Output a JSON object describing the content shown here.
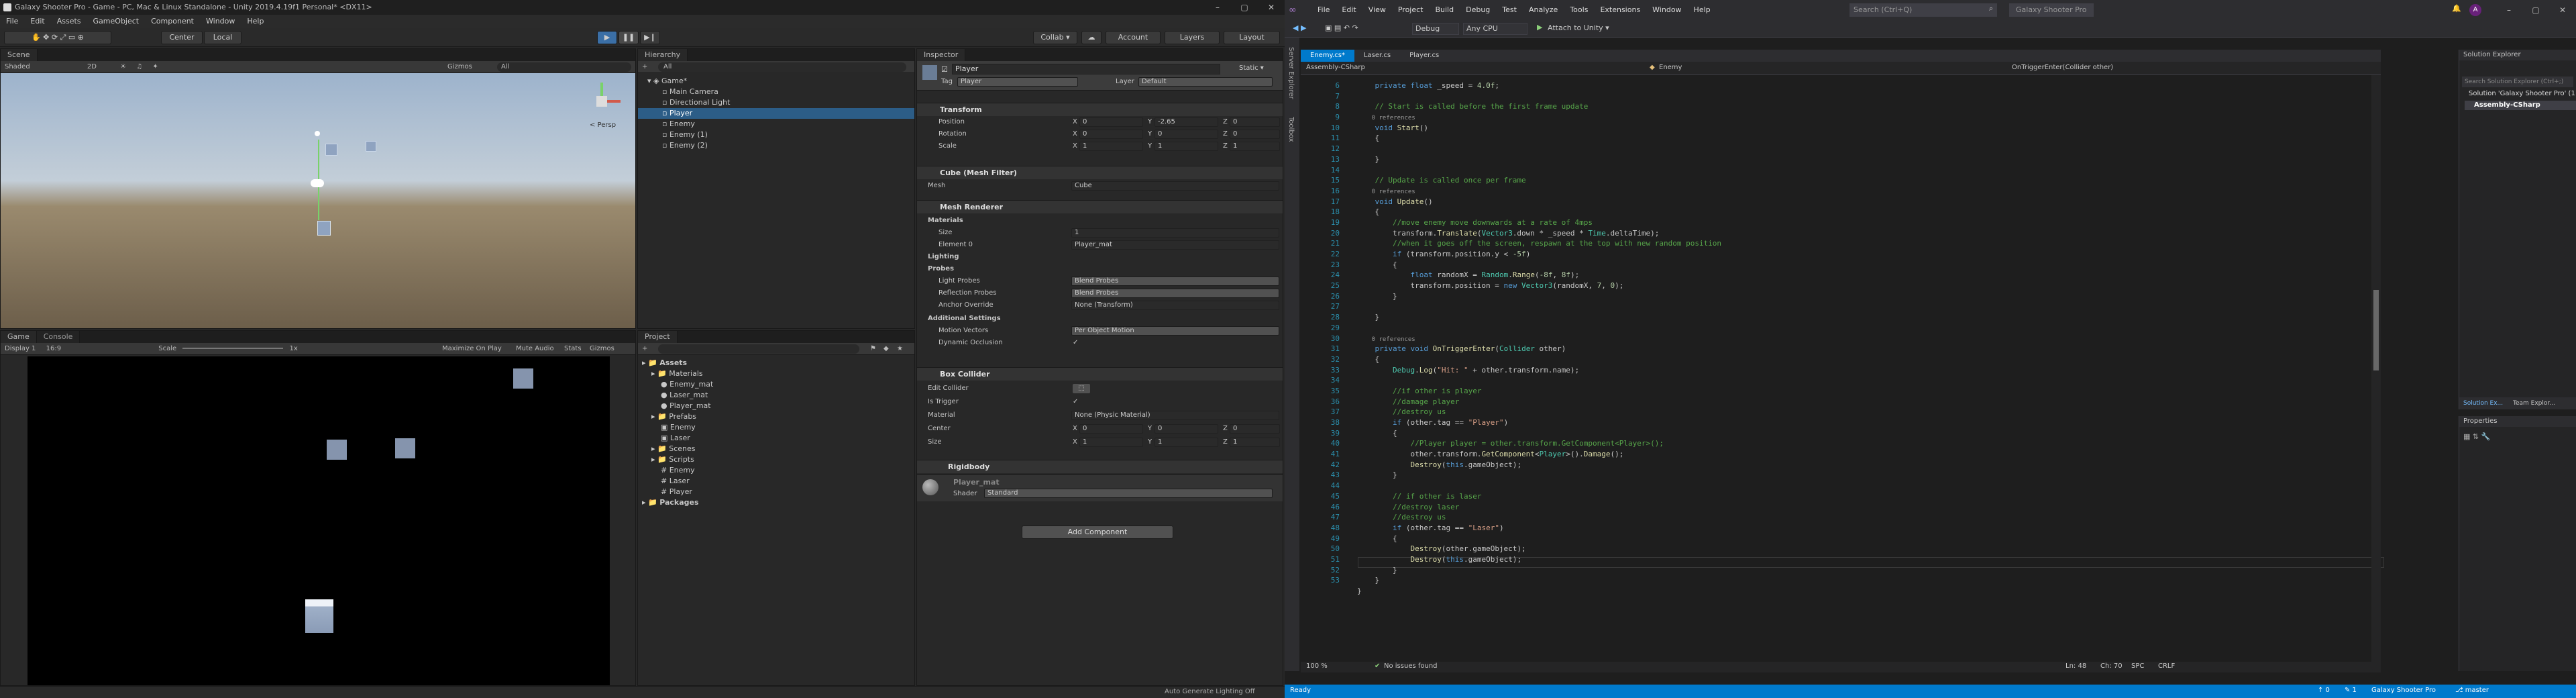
{
  "unity": {
    "title": "Galaxy Shooter Pro - Game - PC, Mac & Linux Standalone - Unity 2019.4.19f1 Personal* <DX11>",
    "menu": [
      "File",
      "Edit",
      "Assets",
      "GameObject",
      "Component",
      "Window",
      "Help"
    ],
    "toolbar": {
      "center": "Center",
      "local": "Local",
      "collab": "Collab ▾",
      "account": "Account",
      "layers": "Layers",
      "layout": "Layout"
    },
    "scene": {
      "tabs": [
        "Scene"
      ],
      "shading": "Shaded",
      "mode2d": "2D",
      "gizmos": "Gizmos",
      "search_placeholder": "All",
      "persp": "< Persp"
    },
    "game": {
      "tabs": [
        "Game",
        "Console"
      ],
      "display": "Display 1",
      "aspect": "16:9",
      "scale_label": "Scale",
      "scale_value": "1x",
      "options": [
        "Maximize On Play",
        "Mute Audio",
        "Stats",
        "Gizmos"
      ]
    },
    "hierarchy": {
      "tab": "Hierarchy",
      "add": "+",
      "search_placeholder": "All",
      "items": [
        {
          "label": "Game*",
          "depth": 0,
          "selected": false
        },
        {
          "label": "Main Camera",
          "depth": 1,
          "selected": false
        },
        {
          "label": "Directional Light",
          "depth": 1,
          "selected": false
        },
        {
          "label": "Player",
          "depth": 1,
          "selected": true
        },
        {
          "label": "Enemy",
          "depth": 1,
          "selected": false
        },
        {
          "label": "Enemy (1)",
          "depth": 1,
          "selected": false
        },
        {
          "label": "Enemy (2)",
          "depth": 1,
          "selected": false
        }
      ]
    },
    "project": {
      "tab": "Project",
      "add": "+",
      "items": [
        {
          "label": "Assets",
          "depth": 0,
          "kind": "folder"
        },
        {
          "label": "Materials",
          "depth": 1,
          "kind": "folder"
        },
        {
          "label": "Enemy_mat",
          "depth": 2,
          "kind": "mat"
        },
        {
          "label": "Laser_mat",
          "depth": 2,
          "kind": "mat"
        },
        {
          "label": "Player_mat",
          "depth": 2,
          "kind": "mat"
        },
        {
          "label": "Prefabs",
          "depth": 1,
          "kind": "folder"
        },
        {
          "label": "Enemy",
          "depth": 2,
          "kind": "prefab"
        },
        {
          "label": "Laser",
          "depth": 2,
          "kind": "prefab"
        },
        {
          "label": "Scenes",
          "depth": 1,
          "kind": "folder"
        },
        {
          "label": "Scripts",
          "depth": 1,
          "kind": "folder"
        },
        {
          "label": "Enemy",
          "depth": 2,
          "kind": "script"
        },
        {
          "label": "Laser",
          "depth": 2,
          "kind": "script"
        },
        {
          "label": "Player",
          "depth": 2,
          "kind": "script"
        },
        {
          "label": "Packages",
          "depth": 0,
          "kind": "folder"
        }
      ]
    },
    "inspector": {
      "tab": "Inspector",
      "object_name": "Player",
      "static_label": "Static ▾",
      "tag_label": "Tag",
      "tag_value": "Player",
      "layer_label": "Layer",
      "layer_value": "Default",
      "transform": {
        "title": "Transform",
        "position": {
          "label": "Position",
          "x": "0",
          "y": "-2.65",
          "z": "0"
        },
        "rotation": {
          "label": "Rotation",
          "x": "0",
          "y": "0",
          "z": "0"
        },
        "scale": {
          "label": "Scale",
          "x": "1",
          "y": "1",
          "z": "1"
        }
      },
      "mesh_filter": {
        "title": "Cube (Mesh Filter)",
        "mesh_label": "Mesh",
        "mesh_value": "Cube"
      },
      "mesh_renderer": {
        "title": "Mesh Renderer",
        "materials": "Materials",
        "size_label": "Size",
        "size_value": "1",
        "element_label": "Element 0",
        "element_value": "Player_mat",
        "lighting": "Lighting",
        "probes": "Probes",
        "light_probes_label": "Light Probes",
        "light_probes_value": "Blend Probes",
        "reflection_probes_label": "Reflection Probes",
        "reflection_probes_value": "Blend Probes",
        "anchor_label": "Anchor Override",
        "anchor_value": "None (Transform)",
        "additional": "Additional Settings",
        "motion_label": "Motion Vectors",
        "motion_value": "Per Object Motion",
        "occlusion_label": "Dynamic Occlusion",
        "occlusion_value": "✓"
      },
      "box_collider": {
        "title": "Box Collider",
        "edit_label": "Edit Collider",
        "trigger_label": "Is Trigger",
        "trigger_value": "✓",
        "material_label": "Material",
        "material_value": "None (Physic Material)",
        "center_label": "Center",
        "center": {
          "x": "0",
          "y": "0",
          "z": "0"
        },
        "size_label": "Size",
        "size": {
          "x": "1",
          "y": "1",
          "z": "1"
        }
      },
      "rigidbody": {
        "title": "Rigidbody"
      },
      "material_preview": {
        "name": "Player_mat",
        "shader_label": "Shader",
        "shader_value": "Standard"
      },
      "add_component": "Add Component"
    },
    "statusbar": "Auto Generate Lighting Off"
  },
  "vs": {
    "menu": [
      "File",
      "Edit",
      "View",
      "Project",
      "Build",
      "Debug",
      "Test",
      "Analyze",
      "Tools",
      "Extensions",
      "Window",
      "Help"
    ],
    "search_placeholder": "Search (Ctrl+Q)",
    "solution_title": "Galaxy Shooter Pro",
    "config": "Debug",
    "platform": "Any CPU",
    "attach": "Attach to Unity ▾",
    "tabs": [
      {
        "label": "Enemy.cs*",
        "active": true
      },
      {
        "label": "Laser.cs",
        "active": false
      },
      {
        "label": "Player.cs",
        "active": false
      }
    ],
    "nav": {
      "project": "Assembly-CSharp",
      "class": "Enemy",
      "member": "OnTriggerEnter(Collider other)"
    },
    "line_numbers": [
      "6",
      "7",
      "8",
      "9",
      "10",
      "11",
      "12",
      "13",
      "14",
      "15",
      "16",
      "17",
      "18",
      "19",
      "20",
      "21",
      "22",
      "23",
      "24",
      "25",
      "26",
      "27",
      "28",
      "29",
      "30",
      "31",
      "32",
      "33",
      "34",
      "35",
      "36",
      "37",
      "38",
      "39",
      "40",
      "41",
      "42",
      "43",
      "44",
      "45",
      "46",
      "47",
      "48",
      "49",
      "50",
      "51",
      "52",
      "53"
    ],
    "zoom": "100 %",
    "issues": "No issues found",
    "position": {
      "ln": "Ln: 48",
      "ch": "Ch: 70",
      "spc": "SPC",
      "crlf": "CRLF"
    },
    "status_ready": "Ready",
    "status_right": [
      "↑ 0",
      "✎ 1",
      "Galaxy Shooter Pro",
      "⎇ master"
    ],
    "solution_explorer": {
      "title": "Solution Explorer",
      "search_placeholder": "Search Solution Explorer (Ctrl+;)",
      "items": [
        "Solution 'Galaxy Shooter Pro' (1 of 1 project)",
        "Assembly-CSharp"
      ],
      "tabs": [
        "Solution Ex...",
        "Team Explor..."
      ]
    },
    "properties": {
      "title": "Properties"
    },
    "side_tabs": [
      "Server Explorer",
      "Toolbox"
    ]
  }
}
